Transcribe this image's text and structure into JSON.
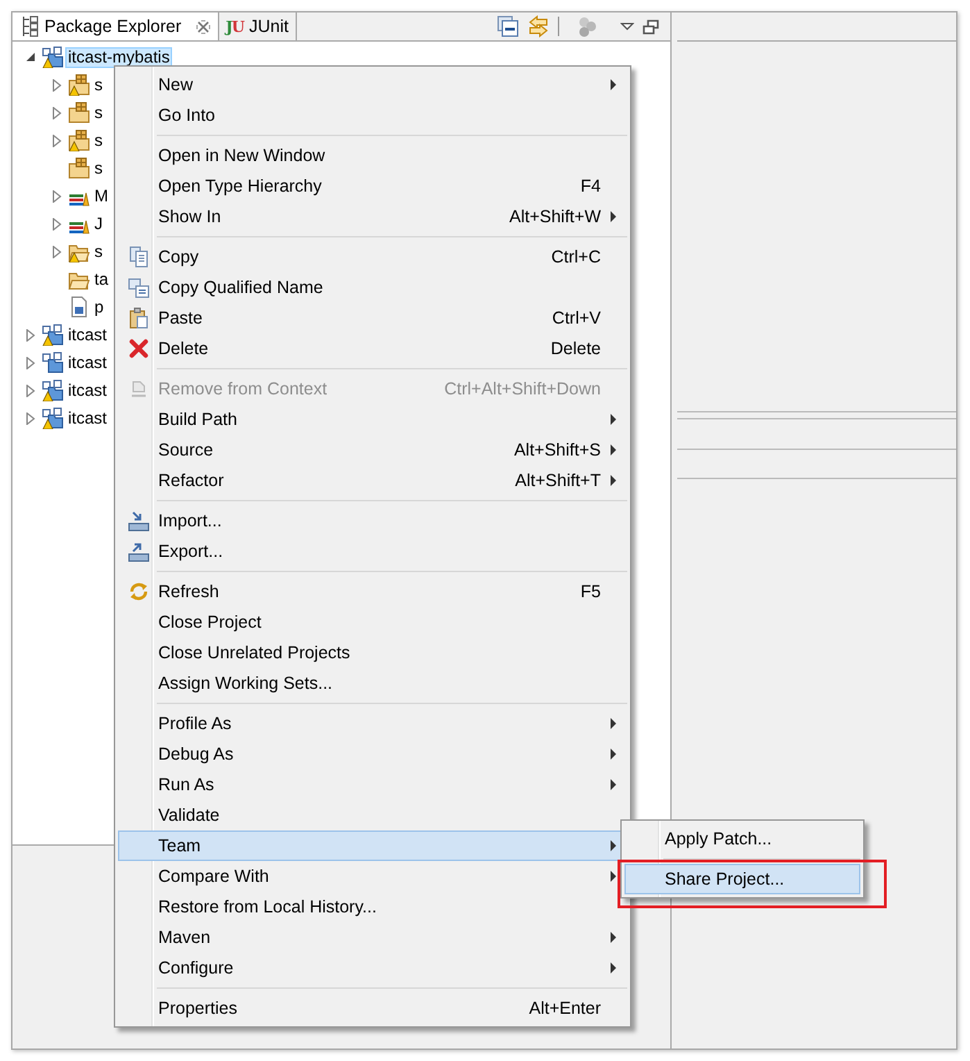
{
  "view_tabs": [
    {
      "label": "Package Explorer",
      "selected": true,
      "closable": true
    },
    {
      "label": "JUnit",
      "icon_text": "JU",
      "selected": false,
      "closable": false
    }
  ],
  "tree": [
    {
      "label": "itcast-mybatis",
      "kind": "project",
      "warning": true,
      "expanded": true,
      "selected": true,
      "children": [
        {
          "label": "s",
          "kind": "source-folder",
          "warning": true,
          "expanded": false,
          "selected": false
        },
        {
          "label": "s",
          "kind": "source-folder",
          "warning": false,
          "expanded": false,
          "selected": false
        },
        {
          "label": "s",
          "kind": "source-folder",
          "warning": true,
          "expanded": false,
          "selected": false
        },
        {
          "label": "s",
          "kind": "source-folder",
          "warning": false,
          "selected": false
        },
        {
          "label": "M",
          "kind": "library",
          "warning": false,
          "expanded": false,
          "selected": false
        },
        {
          "label": "J",
          "kind": "library",
          "warning": false,
          "expanded": false,
          "selected": false
        },
        {
          "label": "s",
          "kind": "folder",
          "warning": true,
          "expanded": false,
          "selected": false
        },
        {
          "label": "ta",
          "kind": "folder",
          "warning": false,
          "selected": false
        },
        {
          "label": "p",
          "kind": "pom-file",
          "warning": false,
          "selected": false
        }
      ]
    },
    {
      "label": "itcast",
      "kind": "project",
      "warning": true,
      "expanded": false,
      "selected": false
    },
    {
      "label": "itcast",
      "kind": "project",
      "warning": false,
      "expanded": false,
      "selected": false
    },
    {
      "label": "itcast",
      "kind": "project",
      "warning": true,
      "expanded": false,
      "selected": false
    },
    {
      "label": "itcast",
      "kind": "project",
      "warning": true,
      "expanded": false,
      "selected": false
    }
  ],
  "context_menu": {
    "groups": [
      [
        {
          "label": "New",
          "submenu": true,
          "disabled": false,
          "selected": false
        },
        {
          "label": "Go Into",
          "submenu": false,
          "disabled": false,
          "selected": false
        }
      ],
      [
        {
          "label": "Open in New Window",
          "submenu": false,
          "disabled": false,
          "selected": false
        },
        {
          "label": "Open Type Hierarchy",
          "shortcut": "F4",
          "submenu": false,
          "disabled": false,
          "selected": false
        },
        {
          "label": "Show In",
          "shortcut": "Alt+Shift+W",
          "submenu": true,
          "disabled": false,
          "selected": false
        }
      ],
      [
        {
          "label": "Copy",
          "shortcut": "Ctrl+C",
          "submenu": false,
          "disabled": false,
          "selected": false
        },
        {
          "label": "Copy Qualified Name",
          "submenu": false,
          "disabled": false,
          "selected": false
        },
        {
          "label": "Paste",
          "shortcut": "Ctrl+V",
          "submenu": false,
          "disabled": false,
          "selected": false
        },
        {
          "label": "Delete",
          "shortcut": "Delete",
          "submenu": false,
          "disabled": false,
          "selected": false
        }
      ],
      [
        {
          "label": "Remove from Context",
          "shortcut": "Ctrl+Alt+Shift+Down",
          "submenu": false,
          "disabled": true,
          "selected": false
        },
        {
          "label": "Build Path",
          "submenu": true,
          "disabled": false,
          "selected": false
        },
        {
          "label": "Source",
          "shortcut": "Alt+Shift+S",
          "submenu": true,
          "disabled": false,
          "selected": false
        },
        {
          "label": "Refactor",
          "shortcut": "Alt+Shift+T",
          "submenu": true,
          "disabled": false,
          "selected": false
        }
      ],
      [
        {
          "label": "Import...",
          "submenu": false,
          "disabled": false,
          "selected": false
        },
        {
          "label": "Export...",
          "submenu": false,
          "disabled": false,
          "selected": false
        }
      ],
      [
        {
          "label": "Refresh",
          "shortcut": "F5",
          "submenu": false,
          "disabled": false,
          "selected": false
        },
        {
          "label": "Close Project",
          "submenu": false,
          "disabled": false,
          "selected": false
        },
        {
          "label": "Close Unrelated Projects",
          "submenu": false,
          "disabled": false,
          "selected": false
        },
        {
          "label": "Assign Working Sets...",
          "submenu": false,
          "disabled": false,
          "selected": false
        }
      ],
      [
        {
          "label": "Profile As",
          "submenu": true,
          "disabled": false,
          "selected": false
        },
        {
          "label": "Debug As",
          "submenu": true,
          "disabled": false,
          "selected": false
        },
        {
          "label": "Run As",
          "submenu": true,
          "disabled": false,
          "selected": false
        },
        {
          "label": "Validate",
          "submenu": false,
          "disabled": false,
          "selected": false
        },
        {
          "label": "Team",
          "submenu": true,
          "disabled": false,
          "selected": true
        },
        {
          "label": "Compare With",
          "submenu": true,
          "disabled": false,
          "selected": false
        },
        {
          "label": "Restore from Local History...",
          "submenu": false,
          "disabled": false,
          "selected": false
        },
        {
          "label": "Maven",
          "submenu": true,
          "disabled": false,
          "selected": false
        },
        {
          "label": "Configure",
          "submenu": true,
          "disabled": false,
          "selected": false
        }
      ],
      [
        {
          "label": "Properties",
          "shortcut": "Alt+Enter",
          "submenu": false,
          "disabled": false,
          "selected": false
        }
      ]
    ]
  },
  "team_submenu": {
    "groups": [
      [
        {
          "label": "Apply Patch...",
          "submenu": false,
          "disabled": false,
          "selected": false
        }
      ],
      [
        {
          "label": "Share Project...",
          "submenu": false,
          "disabled": false,
          "selected": true
        }
      ]
    ]
  }
}
